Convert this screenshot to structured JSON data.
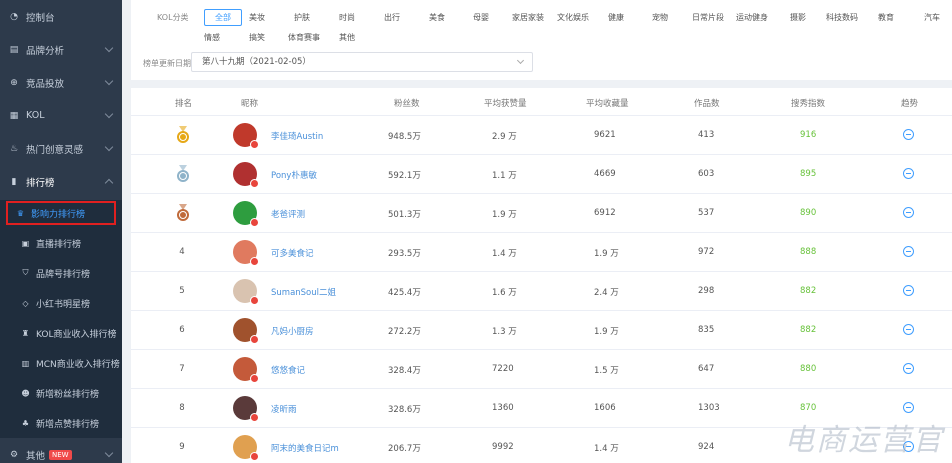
{
  "sidebar": {
    "items": [
      {
        "label": "控制台",
        "icon": "dashboard-icon"
      },
      {
        "label": "品牌分析",
        "icon": "chart-icon"
      },
      {
        "label": "竞品投放",
        "icon": "target-icon"
      },
      {
        "label": "KOL",
        "icon": "document-icon"
      },
      {
        "label": "热门创意灵感",
        "icon": "fire-icon"
      },
      {
        "label": "排行榜",
        "icon": "bar-chart-icon"
      }
    ],
    "sub_items": [
      {
        "label": "影响力排行榜",
        "icon": "crown-icon"
      },
      {
        "label": "直播排行榜",
        "icon": "live-icon"
      },
      {
        "label": "品牌号排行榜",
        "icon": "shield-icon"
      },
      {
        "label": "小红书明星榜",
        "icon": "diamond-icon"
      },
      {
        "label": "KOL商业收入排行榜",
        "icon": "bag-icon"
      },
      {
        "label": "MCN商业收入排行榜",
        "icon": "building-icon"
      },
      {
        "label": "新增粉丝排行榜",
        "icon": "user-icon"
      },
      {
        "label": "新增点赞排行榜",
        "icon": "thumb-icon"
      }
    ],
    "other": {
      "label": "其他",
      "badge": "NEW",
      "icon": "gear-icon"
    }
  },
  "filter": {
    "category_label": "KOL分类",
    "categories_row1": [
      "全部",
      "美妆",
      "护肤",
      "时尚",
      "出行",
      "美食",
      "母婴",
      "家居家装",
      "文化娱乐",
      "健康",
      "宠物",
      "日常片段",
      "运动健身",
      "摄影",
      "科技数码",
      "教育",
      "汽车"
    ],
    "categories_row2": [
      "情感",
      "搞笑",
      "体育赛事",
      "其他"
    ],
    "selected_category": "全部",
    "date_label": "榜单更新日期",
    "date_value": "第八十九期（2021-02-05）"
  },
  "table": {
    "headers": [
      "排名",
      "昵称",
      "粉丝数",
      "平均获赞量",
      "平均收藏量",
      "作品数",
      "搜秀指数",
      "趋势"
    ],
    "rows": [
      {
        "rank": "1",
        "name": "李佳琦Austin",
        "fans": "948.5万",
        "likes": "2.9 万",
        "collects": "9621",
        "works": "413",
        "score": "916",
        "medal": "gold",
        "avatar_color": "#c0392b"
      },
      {
        "rank": "2",
        "name": "Pony朴惠敏",
        "fans": "592.1万",
        "likes": "1.1 万",
        "collects": "4669",
        "works": "603",
        "score": "895",
        "medal": "silver",
        "avatar_color": "#b03030"
      },
      {
        "rank": "3",
        "name": "老爸评测",
        "fans": "501.3万",
        "likes": "1.9 万",
        "collects": "6912",
        "works": "537",
        "score": "890",
        "medal": "bronze",
        "avatar_color": "#2e9d3f"
      },
      {
        "rank": "4",
        "name": "可多美食记",
        "fans": "293.5万",
        "likes": "1.4 万",
        "collects": "1.9 万",
        "works": "972",
        "score": "888",
        "medal": "",
        "avatar_color": "#e07a5f"
      },
      {
        "rank": "5",
        "name": "SumanSoul二姐",
        "fans": "425.4万",
        "likes": "1.6 万",
        "collects": "2.4 万",
        "works": "298",
        "score": "882",
        "medal": "",
        "avatar_color": "#d9c3b0"
      },
      {
        "rank": "6",
        "name": "凡妈小厨房",
        "fans": "272.2万",
        "likes": "1.3 万",
        "collects": "1.9 万",
        "works": "835",
        "score": "882",
        "medal": "",
        "avatar_color": "#a0522d"
      },
      {
        "rank": "7",
        "name": "悠悠食记",
        "fans": "328.4万",
        "likes": "7220",
        "collects": "1.5 万",
        "works": "647",
        "score": "880",
        "medal": "",
        "avatar_color": "#c45a3a"
      },
      {
        "rank": "8",
        "name": "凌昕雨",
        "fans": "328.6万",
        "likes": "1360",
        "collects": "1606",
        "works": "1303",
        "score": "870",
        "medal": "",
        "avatar_color": "#5a3a3a"
      },
      {
        "rank": "9",
        "name": "阿末的美食日记m",
        "fans": "206.7万",
        "likes": "9992",
        "collects": "1.4 万",
        "works": "924",
        "score": "",
        "medal": "",
        "avatar_color": "#e0a050"
      }
    ]
  },
  "watermark": "电商运营官",
  "colors": {
    "sidebar_bg": "#2d3a4b",
    "accent": "#409eff",
    "score_green": "#67c23a",
    "highlight_red": "#e02020"
  }
}
